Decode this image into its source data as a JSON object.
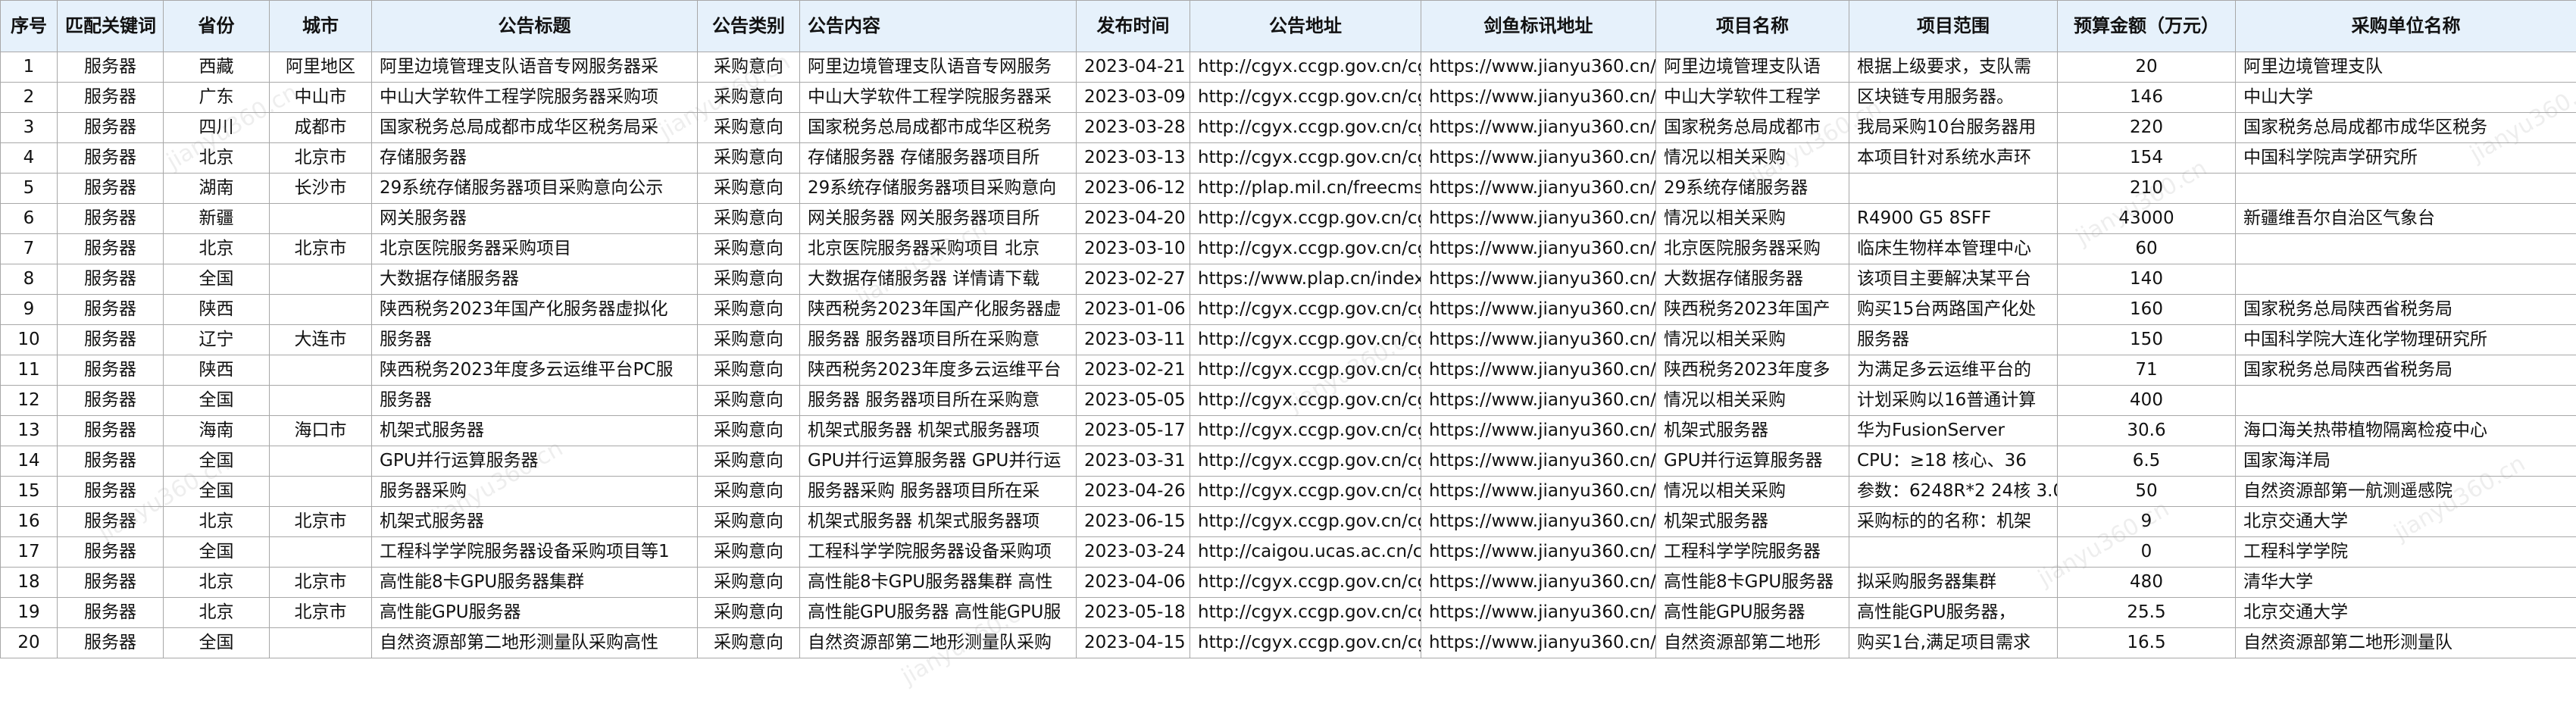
{
  "headers": [
    "序号",
    "匹配关键词",
    "省份",
    "城市",
    "公告标题",
    "公告类别",
    "公告内容",
    "发布时间",
    "公告地址",
    "剑鱼标讯地址",
    "项目名称",
    "项目范围",
    "预算金额（万元）",
    "采购单位名称"
  ],
  "watermark": "jianyu360.cn",
  "rows": [
    [
      "1",
      "服务器",
      "西藏",
      "阿里地区",
      "阿里边境管理支队语音专网服务器采",
      "采购意向",
      "阿里边境管理支队语音专网服务",
      "2023-04-21",
      "http://cgyx.ccgp.gov.cn/cgy",
      "https://www.jianyu360.cn/ar",
      "阿里边境管理支队语",
      "根据上级要求，支队需",
      "20",
      "阿里边境管理支队"
    ],
    [
      "2",
      "服务器",
      "广东",
      "中山市",
      "中山大学软件工程学院服务器采购项",
      "采购意向",
      "中山大学软件工程学院服务器采",
      "2023-03-09",
      "http://cgyx.ccgp.gov.cn/cgy",
      "https://www.jianyu360.cn/ar",
      "中山大学软件工程学",
      "区块链专用服务器。",
      "146",
      "中山大学"
    ],
    [
      "3",
      "服务器",
      "四川",
      "成都市",
      "国家税务总局成都市成华区税务局采",
      "采购意向",
      "国家税务总局成都市成华区税务",
      "2023-03-28",
      "http://cgyx.ccgp.gov.cn/cgy",
      "https://www.jianyu360.cn/ar",
      "国家税务总局成都市",
      "我局采购10台服务器用",
      "220",
      "国家税务总局成都市成华区税务"
    ],
    [
      "4",
      "服务器",
      "北京",
      "北京市",
      "存储服务器",
      "采购意向",
      "存储服务器 存储服务器项目所",
      "2023-03-13",
      "http://cgyx.ccgp.gov.cn/cgy",
      "https://www.jianyu360.cn/ar",
      "情况以相关采购",
      "本项目针对系统水声环",
      "154",
      "中国科学院声学研究所"
    ],
    [
      "5",
      "服务器",
      "湖南",
      "长沙市",
      "29系统存储服务器项目采购意向公示",
      "采购意向",
      "29系统存储服务器项目采购意向",
      "2023-06-12",
      "http://plap.mil.cn/freecms/si",
      "https://www.jianyu360.cn/ar",
      "29系统存储服务器",
      "",
      "210",
      ""
    ],
    [
      "6",
      "服务器",
      "新疆",
      "",
      "网关服务器",
      "采购意向",
      "网关服务器 网关服务器项目所",
      "2023-04-20",
      "http://cgyx.ccgp.gov.cn/cgy",
      "https://www.jianyu360.cn/ar",
      "情况以相关采购",
      "R4900 G5 8SFF",
      "43000",
      "新疆维吾尔自治区气象台"
    ],
    [
      "7",
      "服务器",
      "北京",
      "北京市",
      "北京医院服务器采购项目",
      "采购意向",
      "北京医院服务器采购项目 北京",
      "2023-03-10",
      "http://cgyx.ccgp.gov.cn/cgy",
      "https://www.jianyu360.cn/ar",
      "北京医院服务器采购",
      "临床生物样本管理中心",
      "60",
      ""
    ],
    [
      "8",
      "服务器",
      "全国",
      "",
      "大数据存储服务器",
      "采购意向",
      "大数据存储服务器 详情请下载",
      "2023-02-27",
      "https://www.plap.cn/index/",
      "https://www.jianyu360.cn/ar",
      "大数据存储服务器",
      "该项目主要解决某平台",
      "140",
      ""
    ],
    [
      "9",
      "服务器",
      "陕西",
      "",
      "陕西税务2023年国产化服务器虚拟化",
      "采购意向",
      "陕西税务2023年国产化服务器虚",
      "2023-01-06",
      "http://cgyx.ccgp.gov.cn/cgy",
      "https://www.jianyu360.cn/ar",
      "陕西税务2023年国产",
      "购买15台两路国产化处",
      "160",
      "国家税务总局陕西省税务局"
    ],
    [
      "10",
      "服务器",
      "辽宁",
      "大连市",
      "服务器",
      "采购意向",
      "服务器 服务器项目所在采购意",
      "2023-03-11",
      "http://cgyx.ccgp.gov.cn/cgy",
      "https://www.jianyu360.cn/ar",
      "情况以相关采购",
      "服务器",
      "150",
      "中国科学院大连化学物理研究所"
    ],
    [
      "11",
      "服务器",
      "陕西",
      "",
      "陕西税务2023年度多云运维平台PC服",
      "采购意向",
      "陕西税务2023年度多云运维平台",
      "2023-02-21",
      "http://cgyx.ccgp.gov.cn/cgy",
      "https://www.jianyu360.cn/ar",
      "陕西税务2023年度多",
      "为满足多云运维平台的",
      "71",
      "国家税务总局陕西省税务局"
    ],
    [
      "12",
      "服务器",
      "全国",
      "",
      "服务器",
      "采购意向",
      "服务器 服务器项目所在采购意",
      "2023-05-05",
      "http://cgyx.ccgp.gov.cn/cgy",
      "https://www.jianyu360.cn/ar",
      "情况以相关采购",
      "计划采购以16普通计算",
      "400",
      ""
    ],
    [
      "13",
      "服务器",
      "海南",
      "海口市",
      "机架式服务器",
      "采购意向",
      "机架式服务器 机架式服务器项",
      "2023-05-17",
      "http://cgyx.ccgp.gov.cn/cgy",
      "https://www.jianyu360.cn/ar",
      "机架式服务器",
      "华为FusionServer",
      "30.6",
      "海口海关热带植物隔离检疫中心"
    ],
    [
      "14",
      "服务器",
      "全国",
      "",
      "GPU并行运算服务器",
      "采购意向",
      "GPU并行运算服务器 GPU并行运",
      "2023-03-31",
      "http://cgyx.ccgp.gov.cn/cgy",
      "https://www.jianyu360.cn/ar",
      "GPU并行运算服务器",
      "CPU：≥18 核心、36",
      "6.5",
      "国家海洋局"
    ],
    [
      "15",
      "服务器",
      "全国",
      "",
      "服务器采购",
      "采购意向",
      "服务器采购 服务器项目所在采",
      "2023-04-26",
      "http://cgyx.ccgp.gov.cn/cgy",
      "https://www.jianyu360.cn/ar",
      "情况以相关采购",
      "参数：6248R*2 24核 3.0",
      "50",
      "自然资源部第一航测遥感院"
    ],
    [
      "16",
      "服务器",
      "北京",
      "北京市",
      "机架式服务器",
      "采购意向",
      "机架式服务器 机架式服务器项",
      "2023-06-15",
      "http://cgyx.ccgp.gov.cn/cgy",
      "https://www.jianyu360.cn/ar",
      "机架式服务器",
      "采购标的的名称：机架",
      "9",
      "北京交通大学"
    ],
    [
      "17",
      "服务器",
      "全国",
      "",
      "工程科学学院服务器设备采购项目等1",
      "采购意向",
      "工程科学学院服务器设备采购项",
      "2023-03-24",
      "http://caigou.ucas.ac.cn/cgy",
      "https://www.jianyu360.cn/ar",
      "工程科学学院服务器",
      "",
      "0",
      "工程科学学院"
    ],
    [
      "18",
      "服务器",
      "北京",
      "北京市",
      "高性能8卡GPU服务器集群",
      "采购意向",
      "高性能8卡GPU服务器集群 高性",
      "2023-04-06",
      "http://cgyx.ccgp.gov.cn/cgy",
      "https://www.jianyu360.cn/ar",
      "高性能8卡GPU服务器",
      "拟采购服务器集群",
      "480",
      "清华大学"
    ],
    [
      "19",
      "服务器",
      "北京",
      "北京市",
      "高性能GPU服务器",
      "采购意向",
      "高性能GPU服务器 高性能GPU服",
      "2023-05-18",
      "http://cgyx.ccgp.gov.cn/cgy",
      "https://www.jianyu360.cn/ar",
      "高性能GPU服务器",
      "高性能GPU服务器，",
      "25.5",
      "北京交通大学"
    ],
    [
      "20",
      "服务器",
      "全国",
      "",
      "自然资源部第二地形测量队采购高性",
      "采购意向",
      "自然资源部第二地形测量队采购",
      "2023-04-15",
      "http://cgyx.ccgp.gov.cn/cgy",
      "https://www.jianyu360.cn/ar",
      "自然资源部第二地形",
      "购买1台,满足项目需求",
      "16.5",
      "自然资源部第二地形测量队"
    ]
  ]
}
